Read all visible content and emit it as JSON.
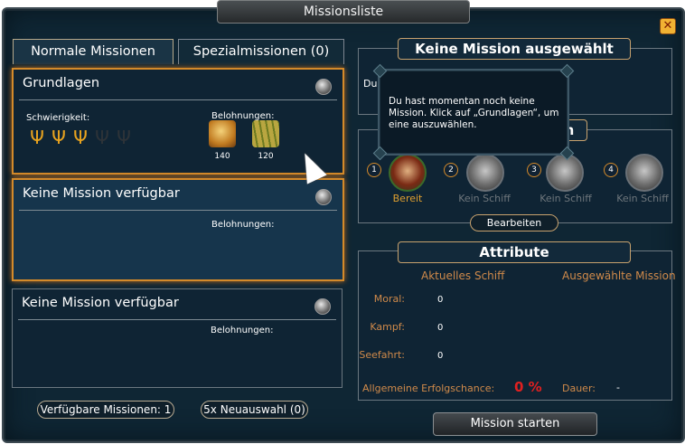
{
  "window": {
    "title": "Missionsliste"
  },
  "tabs": [
    {
      "label": "Normale Missionen"
    },
    {
      "label": "Spezialmissionen (0)"
    }
  ],
  "missions": [
    {
      "title": "Grundlagen",
      "difficulty_label": "Schwierigkeit:",
      "difficulty_level": 3,
      "difficulty_max": 5,
      "rewards_label": "Belohnungen:",
      "rewards": [
        {
          "icon": "gold-coins-icon",
          "value": "140"
        },
        {
          "icon": "bamboo-bundle-icon",
          "value": "120"
        }
      ]
    },
    {
      "title": "Keine Mission verfügbar",
      "rewards_label": "Belohnungen:"
    },
    {
      "title": "Keine Mission verfügbar",
      "rewards_label": "Belohnungen:"
    }
  ],
  "footer": {
    "available_missions": "Verfügbare Missionen: 1",
    "reselect": "5x Neuauswahl (0)",
    "start_button": "Mission starten"
  },
  "selection": {
    "header": "Keine Mission ausgewählt",
    "partial_text": "Du",
    "tooltip": "Du hast momentan noch keine Mission. Klick auf „Grundlagen“, um eine auszuwählen.",
    "fleet_header_partial": "n"
  },
  "fleet": {
    "slots": [
      {
        "number": "1",
        "status": "Bereit"
      },
      {
        "number": "2",
        "status": "Kein Schiff"
      },
      {
        "number": "3",
        "status": "Kein Schiff"
      },
      {
        "number": "4",
        "status": "Kein Schiff"
      }
    ],
    "edit_button": "Bearbeiten"
  },
  "attributes": {
    "header": "Attribute",
    "col_current": "Aktuelles Schiff",
    "col_selected": "Ausgewählte Mission",
    "rows": [
      {
        "label": "Moral:",
        "value": "0"
      },
      {
        "label": "Kampf:",
        "value": "0"
      },
      {
        "label": "Seefahrt:",
        "value": "0"
      }
    ],
    "success_label": "Allgemeine Erfolgschance:",
    "success_value": "0 %",
    "duration_label": "Dauer:",
    "duration_value": "-"
  },
  "colors": {
    "accent_orange": "#d48a2a",
    "ready_green": "#e0a030",
    "success_red": "#e02020",
    "label_orange": "#d08a4a"
  }
}
